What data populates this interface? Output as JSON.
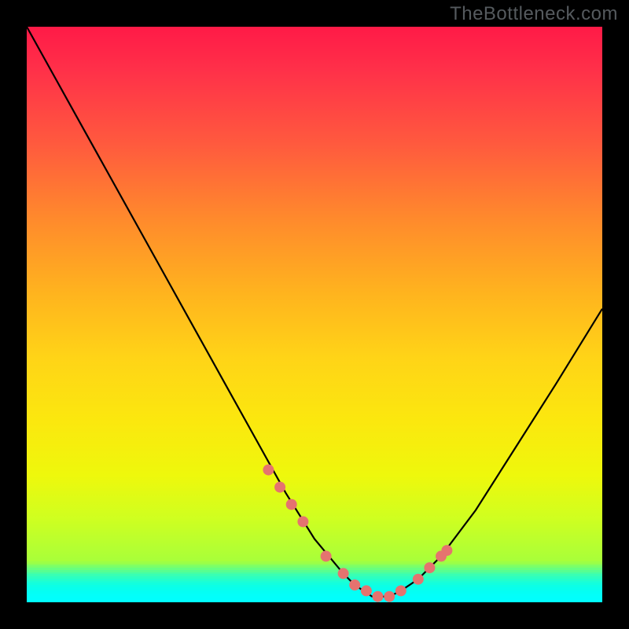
{
  "watermark": "TheBottleneck.com",
  "colors": {
    "frame_bg": "#000000",
    "curve": "#000000",
    "marker_fill": "#e5736f",
    "marker_stroke": "#e5736f",
    "gradient_bottom_lines": [
      "#9dff45",
      "#8dff56",
      "#7aff6a",
      "#68ff7e",
      "#56ff92",
      "#46ffa4",
      "#38ffb4",
      "#2cffc1",
      "#22ffcc",
      "#1affd6",
      "#12ffde",
      "#0cffe6",
      "#08ffec",
      "#06fff1",
      "#04fff5",
      "#03fff9",
      "#02fffb",
      "#01fffd",
      "#00ffff"
    ]
  },
  "chart_data": {
    "type": "line",
    "title": "",
    "xlabel": "",
    "ylabel": "",
    "xlim": [
      0,
      100
    ],
    "ylim": [
      0,
      100
    ],
    "series": [
      {
        "name": "bottleneck-curve",
        "x": [
          0,
          5,
          10,
          15,
          20,
          25,
          30,
          35,
          40,
          45,
          50,
          55,
          57,
          60,
          63,
          65,
          68,
          72,
          78,
          85,
          92,
          100
        ],
        "y": [
          100,
          91,
          82,
          73,
          64,
          55,
          46,
          37,
          28,
          19,
          11,
          5,
          3,
          1,
          1,
          2,
          4,
          8,
          16,
          27,
          38,
          51
        ]
      }
    ],
    "markers": {
      "name": "highlight-dots",
      "x": [
        42,
        44,
        46,
        48,
        52,
        55,
        57,
        59,
        61,
        63,
        65,
        68,
        70,
        72,
        73
      ],
      "y": [
        23,
        20,
        17,
        14,
        8,
        5,
        3,
        2,
        1,
        1,
        2,
        4,
        6,
        8,
        9
      ]
    }
  }
}
